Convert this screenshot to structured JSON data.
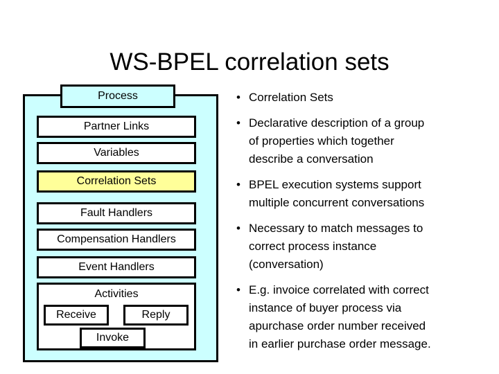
{
  "slide": {
    "title": "WS-BPEL correlation sets",
    "background": "#ffffff"
  },
  "colors": {
    "process_fill": "#ccffff",
    "highlight_fill": "#ffff99",
    "box_fill": "#ffffff",
    "outline": "#000000"
  },
  "diagram": {
    "header_label": "Process",
    "sections": [
      {
        "label": "Partner Links",
        "highlighted": false
      },
      {
        "label": "Variables",
        "highlighted": false
      },
      {
        "label": "Correlation Sets",
        "highlighted": true
      },
      {
        "label": "Fault Handlers",
        "highlighted": false
      },
      {
        "label": "Compensation Handlers",
        "highlighted": false
      },
      {
        "label": "Event Handlers",
        "highlighted": false
      }
    ],
    "activities": {
      "label": "Activities",
      "items": [
        {
          "label": "Receive"
        },
        {
          "label": "Reply"
        },
        {
          "label": "Invoke"
        }
      ]
    }
  },
  "bullets": {
    "marker": "•",
    "items": [
      {
        "text": "Correlation Sets"
      },
      {
        "text": "Declarative description of a group\nof properties which together\ndescribe a conversation"
      },
      {
        "text": " BPEL execution systems support\nmultiple concurrent conversations"
      },
      {
        "text": "Necessary to match messages to\ncorrect process instance\n(conversation)"
      },
      {
        "text": " E.g. invoice correlated with correct\ninstance of buyer process via\napurchase order number received\nin earlier purchase order message."
      }
    ]
  }
}
